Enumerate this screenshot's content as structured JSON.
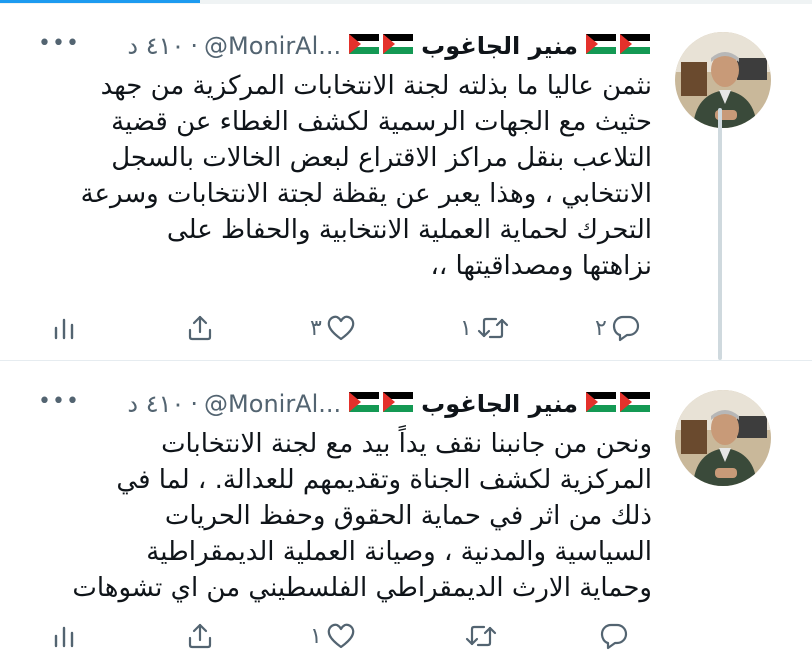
{
  "tweets": [
    {
      "name": "منير الجاغوب",
      "handle": "@MonirAl...",
      "time": "٤١٠ د",
      "separator": "·",
      "more": "•••",
      "lines": [
        "نثمن عاليا ما بذلته لجنة الانتخابات المركزية من جهد",
        "حثيث مع الجهات الرسمية لكشف الغطاء  عن قضية",
        "التلاعب بنقل مراكز الاقتراع لبعض الخالات بالسجل",
        "الانتخابي ، وهذا يعبر عن يقظة لجتة الانتخابات وسرعة",
        "التحرك  لحماية العملية الانتخابية والحفاظ على",
        "نزاهتها ومصداقيتها ،،"
      ],
      "counts": {
        "reply": "٢",
        "retweet": "١",
        "like": "٣"
      }
    },
    {
      "name": "منير الجاغوب",
      "handle": "@MonirAl...",
      "time": "٤١٠ د",
      "separator": "·",
      "more": "•••",
      "lines": [
        "ونحن من جانبنا نقف يداً  بيد مع لجنة الانتخابات",
        "المركزية لكشف الجناة وتقديمهم للعدالة. ، لما في",
        "ذلك من اثر في حماية الحقوق وحفظ الحريات",
        "السياسية والمدنية ،  وصيانة العملية الديمقراطية",
        "وحماية الارث الديمقراطي الفلسطيني من اي تشوهات"
      ],
      "counts": {
        "reply": "",
        "retweet": "",
        "like": "١"
      }
    }
  ],
  "icons": {
    "flag": "palestine-flag-icon",
    "reply": "reply-icon",
    "retweet": "retweet-icon",
    "like": "heart-icon",
    "share": "share-icon",
    "stats": "stats-icon"
  },
  "colors": {
    "text": "#0f1419",
    "secondary": "#536471",
    "accent": "#1d9bf0",
    "thread_line": "#cfd9de"
  }
}
